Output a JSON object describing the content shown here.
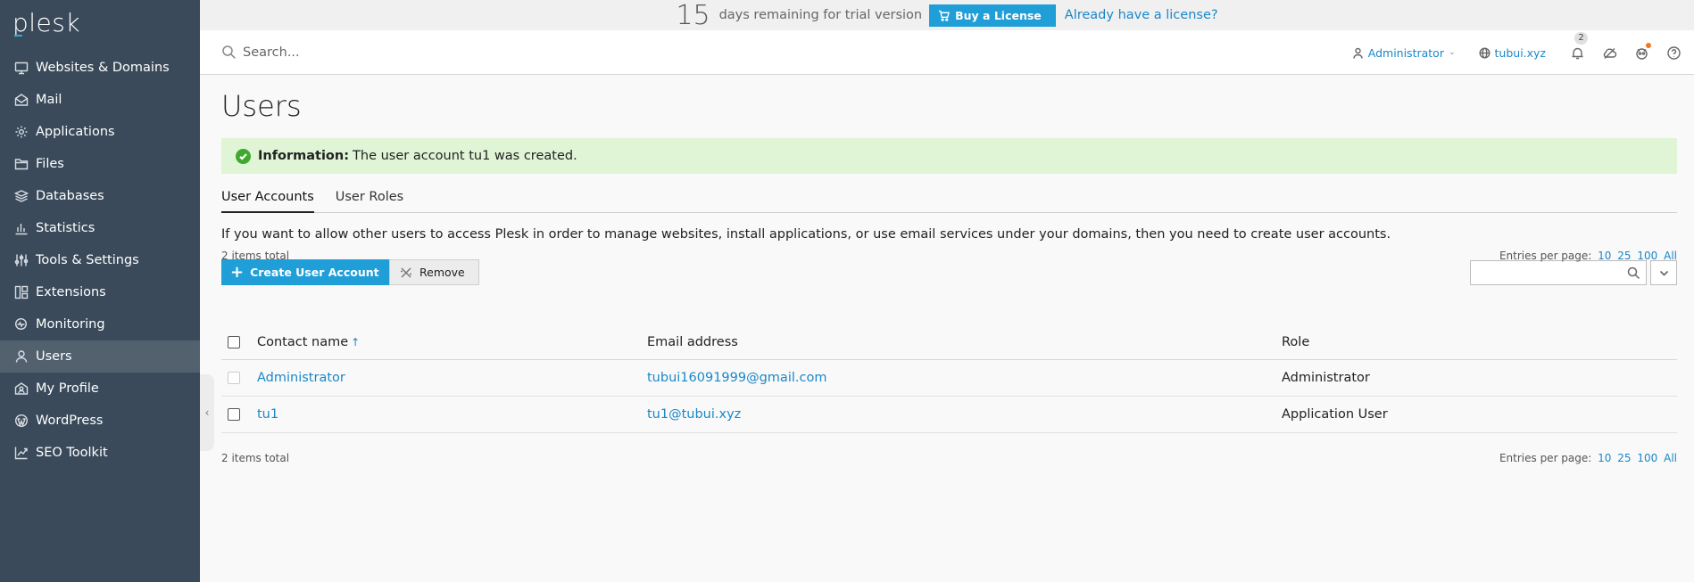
{
  "app": {
    "logo": "plesk"
  },
  "sidebar": {
    "items": [
      {
        "label": "Websites & Domains",
        "icon": "monitor-icon"
      },
      {
        "label": "Mail",
        "icon": "mail-icon"
      },
      {
        "label": "Applications",
        "icon": "gear-icon"
      },
      {
        "label": "Files",
        "icon": "folder-icon"
      },
      {
        "label": "Databases",
        "icon": "database-icon"
      },
      {
        "label": "Statistics",
        "icon": "bar-chart-icon"
      },
      {
        "label": "Tools & Settings",
        "icon": "sliders-icon"
      },
      {
        "label": "Extensions",
        "icon": "puzzle-icon"
      },
      {
        "label": "Monitoring",
        "icon": "monitoring-icon"
      },
      {
        "label": "Users",
        "icon": "user-icon",
        "active": true
      },
      {
        "label": "My Profile",
        "icon": "profile-icon"
      },
      {
        "label": "WordPress",
        "icon": "wordpress-icon"
      },
      {
        "label": "SEO Toolkit",
        "icon": "trend-icon"
      }
    ]
  },
  "trial": {
    "days": "15",
    "text": "days remaining for trial version",
    "buy_label": "Buy a License",
    "already_label": "Already have a license?"
  },
  "header": {
    "search_placeholder": "Search...",
    "user_label": "Administrator",
    "domain_label": "tubui.xyz",
    "notification_count": "2"
  },
  "page": {
    "title": "Users",
    "message_label": "Information:",
    "message_text": "The user account tu1 was created.",
    "tabs": [
      {
        "label": "User Accounts",
        "active": true
      },
      {
        "label": "User Roles",
        "active": false
      }
    ],
    "description": "If you want to allow other users to access Plesk in order to manage websites, install applications, or use email services under your domains, then you need to create user accounts.",
    "create_label": "Create User Account",
    "remove_label": "Remove",
    "items_total": "2 items total",
    "entries_label": "Entries per page:",
    "entries_options": [
      "10",
      "25",
      "100",
      "All"
    ]
  },
  "table": {
    "columns": [
      "Contact name",
      "Email address",
      "Role"
    ],
    "rows": [
      {
        "name": "Administrator",
        "email": "tubui16091999@gmail.com",
        "role": "Administrator",
        "checkbox_disabled": true
      },
      {
        "name": "tu1",
        "email": "tu1@tubui.xyz",
        "role": "Application User",
        "checkbox_disabled": false
      }
    ]
  },
  "colors": {
    "sidebar_bg": "#3a4a5a",
    "sidebar_active": "#53616f",
    "accent": "#1f9ed8",
    "link": "#1a87c9",
    "success_bg": "#dff5d6",
    "success_icon": "#3fa92d"
  }
}
